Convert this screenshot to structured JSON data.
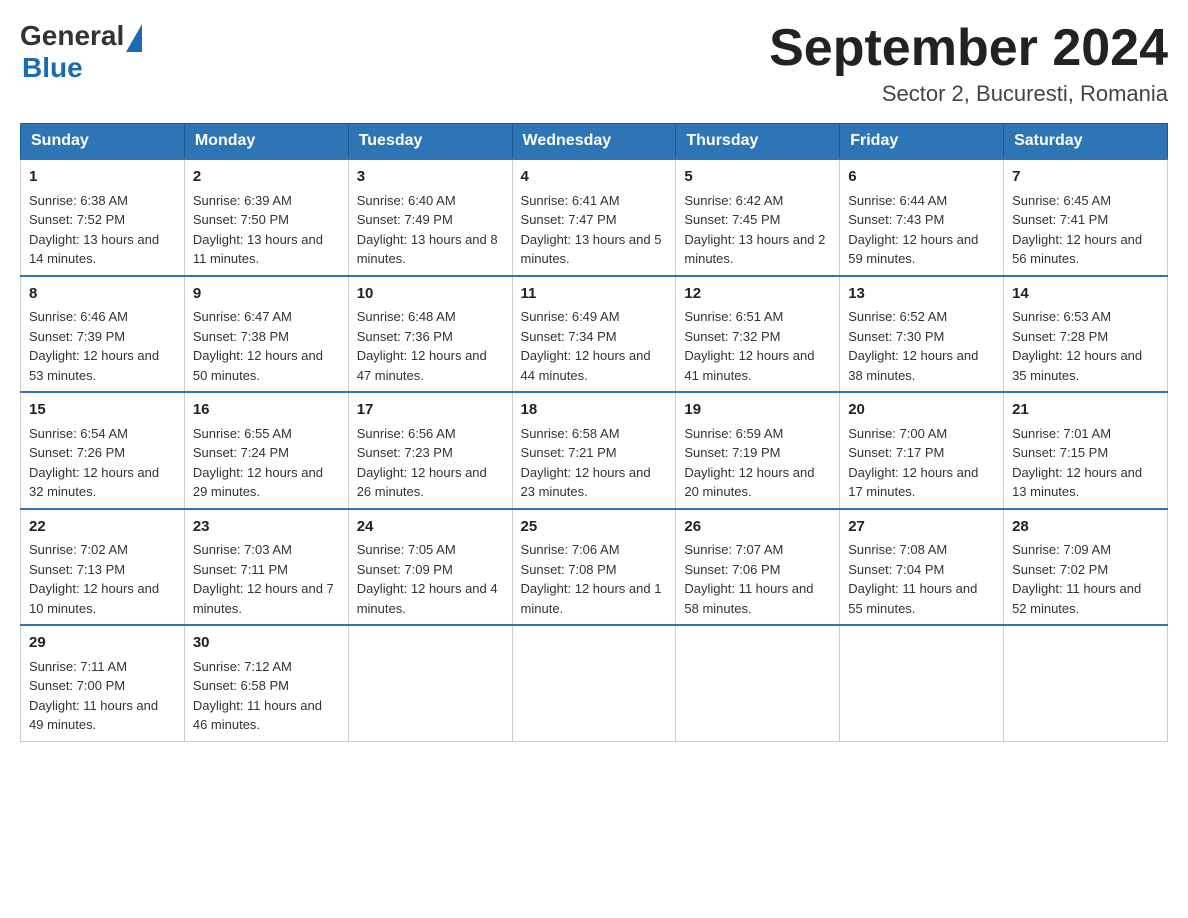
{
  "logo": {
    "general": "General",
    "blue": "Blue"
  },
  "title": "September 2024",
  "subtitle": "Sector 2, Bucuresti, Romania",
  "days": [
    "Sunday",
    "Monday",
    "Tuesday",
    "Wednesday",
    "Thursday",
    "Friday",
    "Saturday"
  ],
  "weeks": [
    [
      {
        "day": "1",
        "sunrise": "Sunrise: 6:38 AM",
        "sunset": "Sunset: 7:52 PM",
        "daylight": "Daylight: 13 hours and 14 minutes."
      },
      {
        "day": "2",
        "sunrise": "Sunrise: 6:39 AM",
        "sunset": "Sunset: 7:50 PM",
        "daylight": "Daylight: 13 hours and 11 minutes."
      },
      {
        "day": "3",
        "sunrise": "Sunrise: 6:40 AM",
        "sunset": "Sunset: 7:49 PM",
        "daylight": "Daylight: 13 hours and 8 minutes."
      },
      {
        "day": "4",
        "sunrise": "Sunrise: 6:41 AM",
        "sunset": "Sunset: 7:47 PM",
        "daylight": "Daylight: 13 hours and 5 minutes."
      },
      {
        "day": "5",
        "sunrise": "Sunrise: 6:42 AM",
        "sunset": "Sunset: 7:45 PM",
        "daylight": "Daylight: 13 hours and 2 minutes."
      },
      {
        "day": "6",
        "sunrise": "Sunrise: 6:44 AM",
        "sunset": "Sunset: 7:43 PM",
        "daylight": "Daylight: 12 hours and 59 minutes."
      },
      {
        "day": "7",
        "sunrise": "Sunrise: 6:45 AM",
        "sunset": "Sunset: 7:41 PM",
        "daylight": "Daylight: 12 hours and 56 minutes."
      }
    ],
    [
      {
        "day": "8",
        "sunrise": "Sunrise: 6:46 AM",
        "sunset": "Sunset: 7:39 PM",
        "daylight": "Daylight: 12 hours and 53 minutes."
      },
      {
        "day": "9",
        "sunrise": "Sunrise: 6:47 AM",
        "sunset": "Sunset: 7:38 PM",
        "daylight": "Daylight: 12 hours and 50 minutes."
      },
      {
        "day": "10",
        "sunrise": "Sunrise: 6:48 AM",
        "sunset": "Sunset: 7:36 PM",
        "daylight": "Daylight: 12 hours and 47 minutes."
      },
      {
        "day": "11",
        "sunrise": "Sunrise: 6:49 AM",
        "sunset": "Sunset: 7:34 PM",
        "daylight": "Daylight: 12 hours and 44 minutes."
      },
      {
        "day": "12",
        "sunrise": "Sunrise: 6:51 AM",
        "sunset": "Sunset: 7:32 PM",
        "daylight": "Daylight: 12 hours and 41 minutes."
      },
      {
        "day": "13",
        "sunrise": "Sunrise: 6:52 AM",
        "sunset": "Sunset: 7:30 PM",
        "daylight": "Daylight: 12 hours and 38 minutes."
      },
      {
        "day": "14",
        "sunrise": "Sunrise: 6:53 AM",
        "sunset": "Sunset: 7:28 PM",
        "daylight": "Daylight: 12 hours and 35 minutes."
      }
    ],
    [
      {
        "day": "15",
        "sunrise": "Sunrise: 6:54 AM",
        "sunset": "Sunset: 7:26 PM",
        "daylight": "Daylight: 12 hours and 32 minutes."
      },
      {
        "day": "16",
        "sunrise": "Sunrise: 6:55 AM",
        "sunset": "Sunset: 7:24 PM",
        "daylight": "Daylight: 12 hours and 29 minutes."
      },
      {
        "day": "17",
        "sunrise": "Sunrise: 6:56 AM",
        "sunset": "Sunset: 7:23 PM",
        "daylight": "Daylight: 12 hours and 26 minutes."
      },
      {
        "day": "18",
        "sunrise": "Sunrise: 6:58 AM",
        "sunset": "Sunset: 7:21 PM",
        "daylight": "Daylight: 12 hours and 23 minutes."
      },
      {
        "day": "19",
        "sunrise": "Sunrise: 6:59 AM",
        "sunset": "Sunset: 7:19 PM",
        "daylight": "Daylight: 12 hours and 20 minutes."
      },
      {
        "day": "20",
        "sunrise": "Sunrise: 7:00 AM",
        "sunset": "Sunset: 7:17 PM",
        "daylight": "Daylight: 12 hours and 17 minutes."
      },
      {
        "day": "21",
        "sunrise": "Sunrise: 7:01 AM",
        "sunset": "Sunset: 7:15 PM",
        "daylight": "Daylight: 12 hours and 13 minutes."
      }
    ],
    [
      {
        "day": "22",
        "sunrise": "Sunrise: 7:02 AM",
        "sunset": "Sunset: 7:13 PM",
        "daylight": "Daylight: 12 hours and 10 minutes."
      },
      {
        "day": "23",
        "sunrise": "Sunrise: 7:03 AM",
        "sunset": "Sunset: 7:11 PM",
        "daylight": "Daylight: 12 hours and 7 minutes."
      },
      {
        "day": "24",
        "sunrise": "Sunrise: 7:05 AM",
        "sunset": "Sunset: 7:09 PM",
        "daylight": "Daylight: 12 hours and 4 minutes."
      },
      {
        "day": "25",
        "sunrise": "Sunrise: 7:06 AM",
        "sunset": "Sunset: 7:08 PM",
        "daylight": "Daylight: 12 hours and 1 minute."
      },
      {
        "day": "26",
        "sunrise": "Sunrise: 7:07 AM",
        "sunset": "Sunset: 7:06 PM",
        "daylight": "Daylight: 11 hours and 58 minutes."
      },
      {
        "day": "27",
        "sunrise": "Sunrise: 7:08 AM",
        "sunset": "Sunset: 7:04 PM",
        "daylight": "Daylight: 11 hours and 55 minutes."
      },
      {
        "day": "28",
        "sunrise": "Sunrise: 7:09 AM",
        "sunset": "Sunset: 7:02 PM",
        "daylight": "Daylight: 11 hours and 52 minutes."
      }
    ],
    [
      {
        "day": "29",
        "sunrise": "Sunrise: 7:11 AM",
        "sunset": "Sunset: 7:00 PM",
        "daylight": "Daylight: 11 hours and 49 minutes."
      },
      {
        "day": "30",
        "sunrise": "Sunrise: 7:12 AM",
        "sunset": "Sunset: 6:58 PM",
        "daylight": "Daylight: 11 hours and 46 minutes."
      },
      null,
      null,
      null,
      null,
      null
    ]
  ]
}
